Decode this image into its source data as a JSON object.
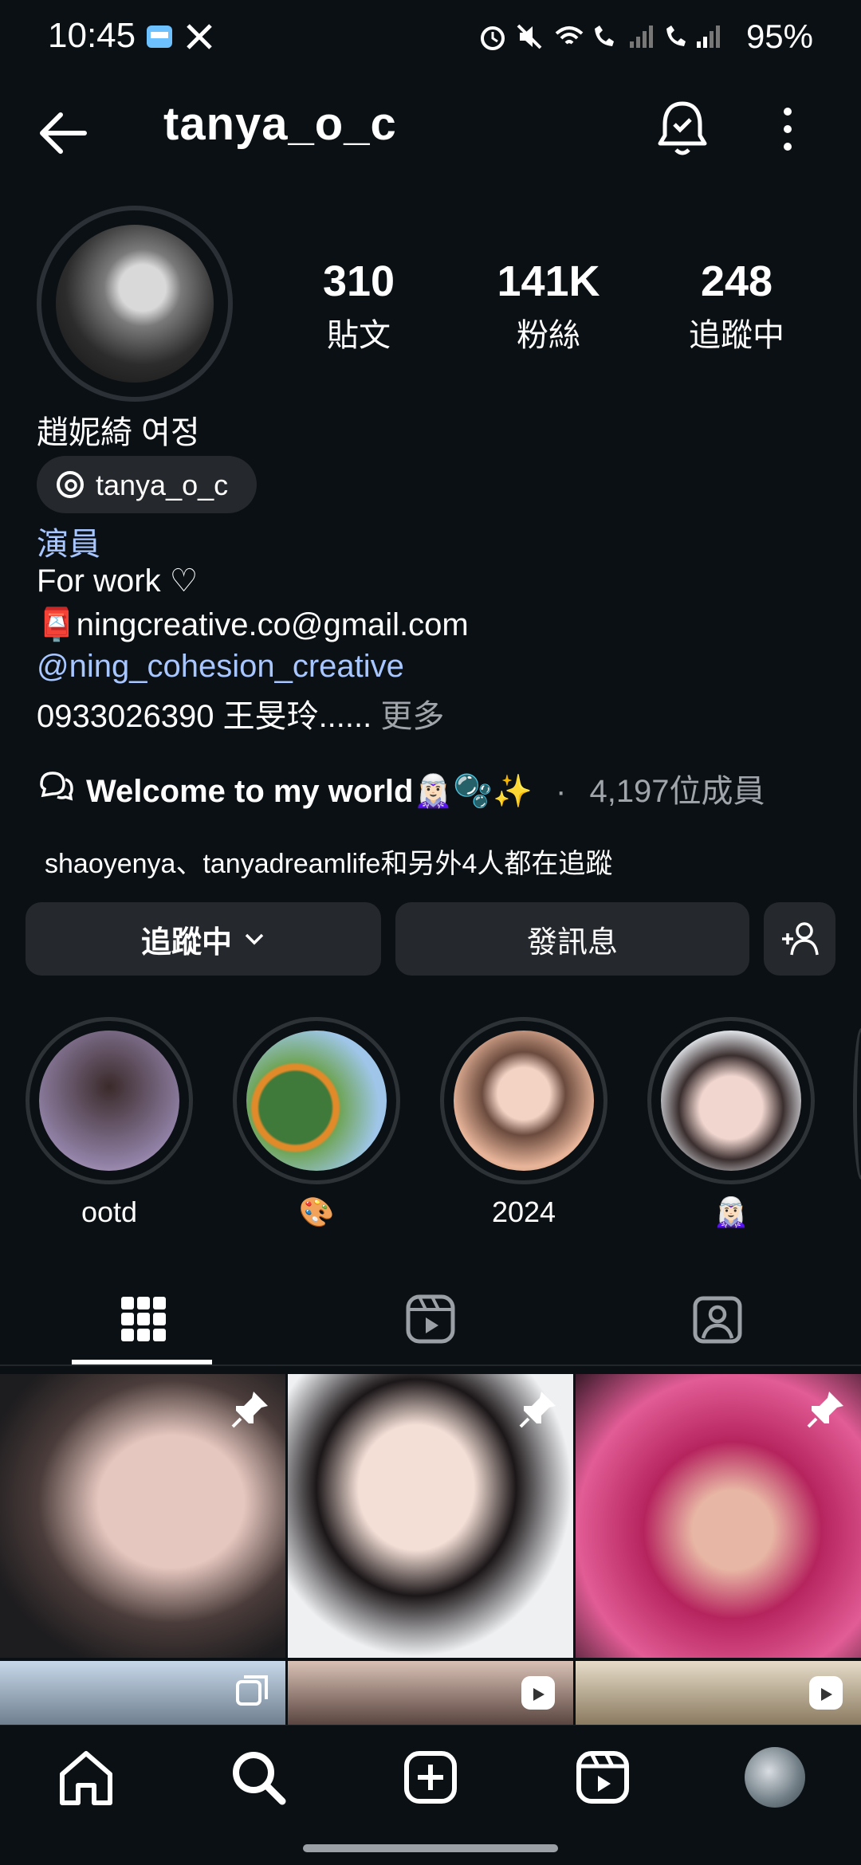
{
  "status_bar": {
    "time": "10:45",
    "battery": "95%"
  },
  "header": {
    "username": "tanya_o_c"
  },
  "stats": [
    {
      "value": "310",
      "label": "貼文"
    },
    {
      "value": "141K",
      "label": "粉絲"
    },
    {
      "value": "248",
      "label": "追蹤中"
    }
  ],
  "profile": {
    "display_name": "趙妮綺 여정",
    "threads_handle": "tanya_o_c",
    "category": "演員",
    "bio_line1": "For work ♡",
    "bio_line2": "📮ningcreative.co@gmail.com",
    "bio_link": "@ning_cohesion_creative",
    "bio_line4": "0933026390 王旻玲......",
    "more": "更多"
  },
  "channel": {
    "name": "Welcome to my world🧝🏻‍♀️🫧✨",
    "separator": "·",
    "members": "4,197位成員"
  },
  "followed_by": "shaoyenya、tanyadreamlife和另外4人都在追蹤",
  "buttons": {
    "following": "追蹤中",
    "message": "發訊息"
  },
  "highlights": [
    {
      "label": "ootd"
    },
    {
      "label": "🎨"
    },
    {
      "label": "2024"
    },
    {
      "label": "🧝🏻‍♀️"
    }
  ],
  "colors": {
    "background": "#0b1014",
    "button": "#25292e",
    "link": "#a8c6ff"
  }
}
